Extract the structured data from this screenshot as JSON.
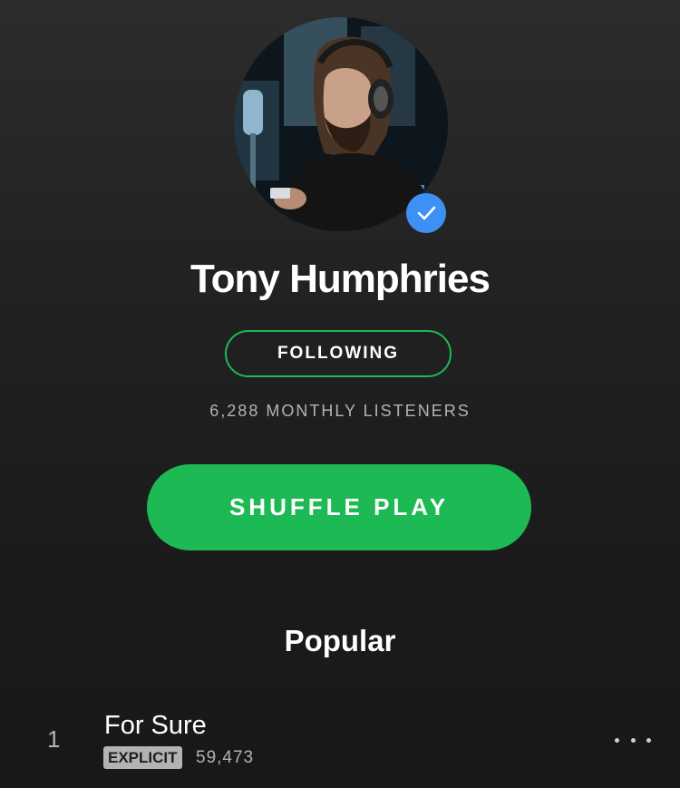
{
  "artist": {
    "name": "Tony Humphries",
    "verified": true,
    "avatar_icon": "artist-photo",
    "verified_icon": "checkmark-icon",
    "verified_color": "#3d91f4"
  },
  "follow_button": {
    "label": "FOLLOWING",
    "border_color": "#1db954"
  },
  "stats": {
    "monthly_listeners": "6,288 MONTHLY LISTENERS"
  },
  "shuffle_button": {
    "label": "SHUFFLE PLAY",
    "color": "#1db954"
  },
  "popular": {
    "title": "Popular",
    "tracks": [
      {
        "number": "1",
        "title": "For Sure",
        "explicit_label": "EXPLICIT",
        "plays": "59,473",
        "more_icon": "more-options-icon"
      }
    ]
  },
  "colors": {
    "background": "#1e1e1e",
    "text_primary": "#ffffff",
    "text_secondary": "#b3b3b3"
  }
}
